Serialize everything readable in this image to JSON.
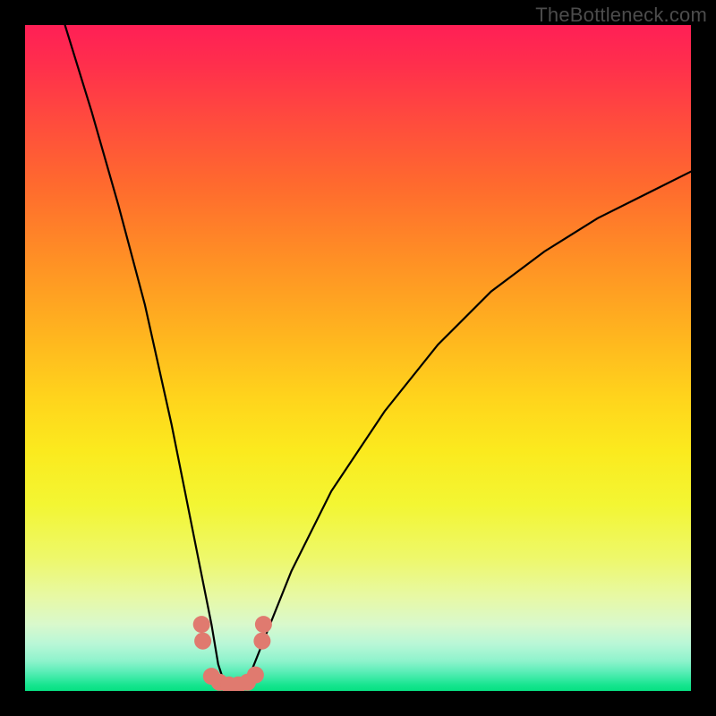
{
  "watermark": "TheBottleneck.com",
  "colors": {
    "page_bg": "#000000",
    "curve": "#000000",
    "marker": "#e07a6f",
    "gradient_top": "#ff1f56",
    "gradient_mid": "#ffe11c",
    "gradient_bottom": "#07e183"
  },
  "chart_data": {
    "type": "line",
    "title": "",
    "xlabel": "",
    "ylabel": "",
    "xlim": [
      0,
      100
    ],
    "ylim": [
      0,
      100
    ],
    "grid": false,
    "legend": false,
    "note": "x is relative horizontal position (0=left,100=right); y is mismatch/bottleneck magnitude (0=bottom/green optimal,100=top/red severe). Curve dips to a narrow optimal zone near x≈30 and rises sharply on both sides.",
    "series": [
      {
        "name": "bottleneck-curve",
        "x": [
          6,
          10,
          14,
          18,
          22,
          24,
          26,
          28,
          29,
          30,
          31,
          32,
          33,
          34,
          36,
          40,
          46,
          54,
          62,
          70,
          78,
          86,
          94,
          100
        ],
        "y": [
          100,
          87,
          73,
          58,
          40,
          30,
          20,
          10,
          4,
          1,
          0.5,
          0.5,
          1,
          3,
          8,
          18,
          30,
          42,
          52,
          60,
          66,
          71,
          75,
          78
        ]
      }
    ],
    "markers": {
      "name": "highlighted-range",
      "note": "Salmon dots marking the near-optimal band of the curve, with short stacked pairs at the band edges.",
      "points_xy": [
        [
          26.5,
          10
        ],
        [
          26.7,
          7.5
        ],
        [
          28.0,
          2.2
        ],
        [
          29.2,
          1.3
        ],
        [
          30.6,
          0.9
        ],
        [
          32.0,
          0.9
        ],
        [
          33.4,
          1.3
        ],
        [
          34.6,
          2.4
        ],
        [
          35.6,
          7.5
        ],
        [
          35.8,
          10
        ]
      ]
    }
  }
}
